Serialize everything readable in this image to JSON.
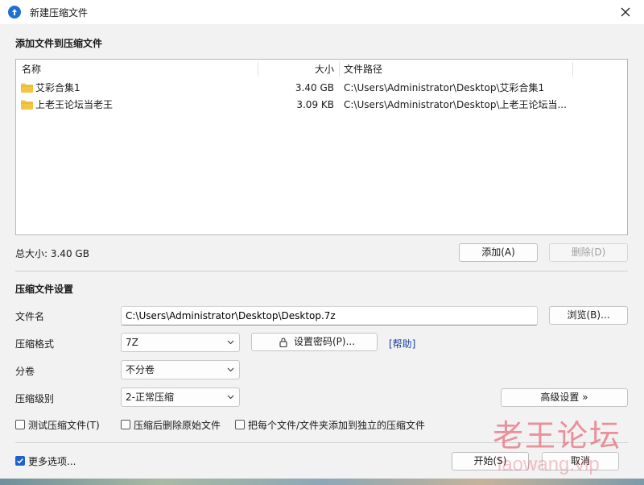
{
  "window": {
    "title": "新建压缩文件",
    "close_icon": "close-icon"
  },
  "add_section": {
    "title": "添加文件到压缩文件",
    "columns": [
      "名称",
      "大小",
      "文件路径"
    ],
    "rows": [
      {
        "name": "艾彩合集1",
        "size": "3.40 GB",
        "path": "C:\\Users\\Administrator\\Desktop\\艾彩合集1"
      },
      {
        "name": "上老王论坛当老王",
        "size": "3.09 KB",
        "path": "C:\\Users\\Administrator\\Desktop\\上老王论坛当..."
      }
    ],
    "total_size": "总大小: 3.40 GB",
    "add_button": "添加(A)",
    "delete_button": "删除(D)"
  },
  "settings": {
    "title": "压缩文件设置",
    "filename_label": "文件名",
    "filename_value": "C:\\Users\\Administrator\\Desktop\\Desktop.7z",
    "browse_button": "浏览(B)...",
    "format_label": "压缩格式",
    "format_value": "7Z",
    "password_button": "设置密码(P)...",
    "help_link": "[帮助]",
    "split_label": "分卷",
    "split_value": "不分卷",
    "level_label": "压缩级别",
    "level_value": "2-正常压缩",
    "advanced_button": "高级设置 »",
    "options": [
      {
        "label": "测试压缩文件(T)",
        "checked": false
      },
      {
        "label": "压缩后删除原始文件",
        "checked": false
      },
      {
        "label": "把每个文件/文件夹添加到独立的压缩文件",
        "checked": false
      }
    ]
  },
  "footer": {
    "more_options": "更多选项...",
    "more_options_checked": true,
    "start_button": "开始(S)",
    "cancel_button": "取消"
  },
  "watermark": {
    "text": "老王论坛",
    "url": "laowang.vip"
  },
  "colors": {
    "accent": "#1f63c6",
    "link": "#1b3fa8",
    "folder": "#f4c542"
  }
}
